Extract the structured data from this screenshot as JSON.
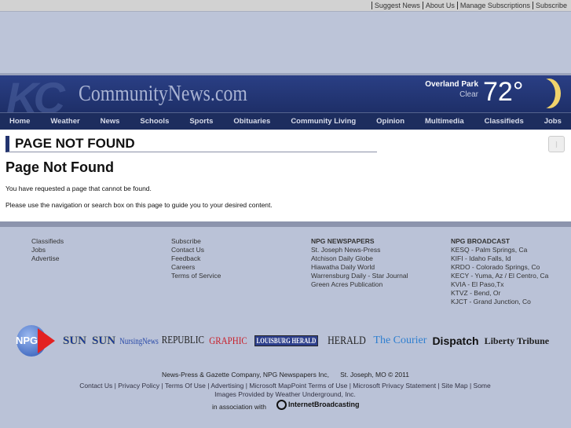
{
  "topbar": {
    "links": [
      "Suggest News",
      "About Us",
      "Manage Subscriptions",
      "Subscribe"
    ]
  },
  "header": {
    "logo_mark": "KC",
    "site_name": "CommunityNews.com",
    "weather": {
      "location": "Overland Park",
      "condition": "Clear",
      "temperature": "72°",
      "icon": "crescent-moon-icon"
    }
  },
  "nav": [
    "Home",
    "Weather",
    "News",
    "Schools",
    "Sports",
    "Obituaries",
    "Community Living",
    "Opinion",
    "Multimedia",
    "Classifieds",
    "Jobs"
  ],
  "main": {
    "section_title": "PAGE NOT FOUND",
    "heading": "Page Not Found",
    "para1": "You have requested a page that cannot be found.",
    "para2": "Please use the navigation or search box on this page to guide you to your desired content.",
    "rss_icon": "rss-icon"
  },
  "footer": {
    "col1": [
      "Classifieds",
      "Jobs",
      "Advertise"
    ],
    "col2": [
      "Subscribe",
      "Contact Us",
      "Feedback",
      "Careers",
      "Terms of Service"
    ],
    "col3": {
      "title": "NPG NEWSPAPERS",
      "items": [
        "St. Joseph News-Press",
        "Atchison Daily Globe",
        "Hiawatha Daily World",
        "Warrensburg Daily - Star Journal",
        "Green Acres Publication"
      ]
    },
    "col4": {
      "title": "NPG BROADCAST",
      "items": [
        "KESQ - Palm Springs, Ca",
        "KIFI - Idaho Falls, Id",
        "KRDO - Colorado Springs, Co",
        "KECY - Yuma, Az / El Centro, Ca",
        "KVIA - El Paso,Tx",
        "KTVZ - Bend, Or",
        "KJCT - Grand Junction, Co"
      ]
    },
    "logos": [
      "NPG",
      "SUN",
      "SUN",
      "NursingNews",
      "REPUBLIC",
      "GRAPHIC",
      "LOUISBURG HERALD",
      "HERALD",
      "The Courier",
      "Dispatch",
      "Liberty Tribune"
    ],
    "copyright": "News-Press & Gazette Company, NPG Newspapers Inc,      St. Joseph, MO © 2011",
    "links": [
      "Contact Us",
      "Privacy Policy",
      "Terms Of Use",
      "Advertising",
      "Microsoft MapPoint Terms of Use",
      "Microsoft Privacy Statement",
      "Site Map"
    ],
    "links_tail": "Some Images Provided by Weather Underground, Inc.",
    "assoc": "in association with",
    "partner": "InternetBroadcasting"
  }
}
